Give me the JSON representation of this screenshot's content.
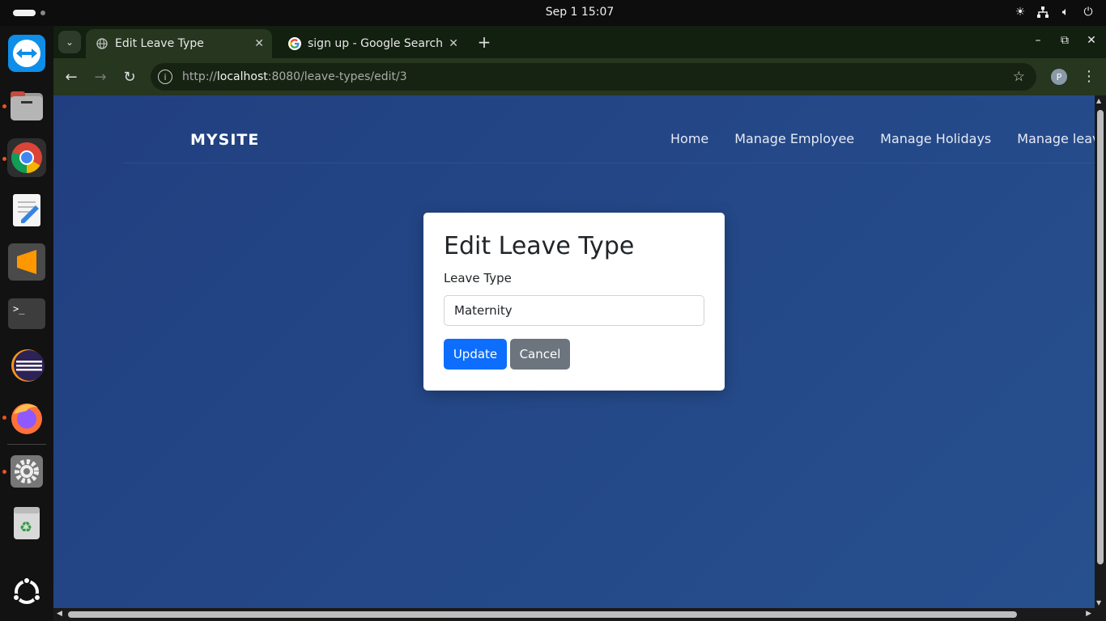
{
  "system": {
    "clock": "Sep 1  15:07",
    "tray_icons": [
      "brightness-icon",
      "network-icon",
      "volume-icon",
      "power-icon"
    ]
  },
  "dock": {
    "apps": [
      "teamviewer",
      "files",
      "chrome",
      "text-editor",
      "sublime-text",
      "terminal",
      "eclipse",
      "firefox",
      "settings",
      "trash",
      "ubuntu-apps"
    ]
  },
  "browser": {
    "tabs": [
      {
        "title": "Edit Leave Type",
        "active": true
      },
      {
        "title": "sign up - Google Search",
        "active": false
      }
    ],
    "url_prefix": "http://",
    "url_host": "localhost",
    "url_rest": ":8080/leave-types/edit/3",
    "profile_initial": "P"
  },
  "site": {
    "brand": "MYSITE",
    "nav": [
      "Home",
      "Manage Employee",
      "Manage Holidays",
      "Manage leaves"
    ]
  },
  "form": {
    "title": "Edit Leave Type",
    "label": "Leave Type",
    "value": "Maternity",
    "update_label": "Update",
    "cancel_label": "Cancel"
  },
  "colors": {
    "page_bg": "#24478a",
    "primary": "#0d6efd",
    "secondary": "#6c757d"
  }
}
